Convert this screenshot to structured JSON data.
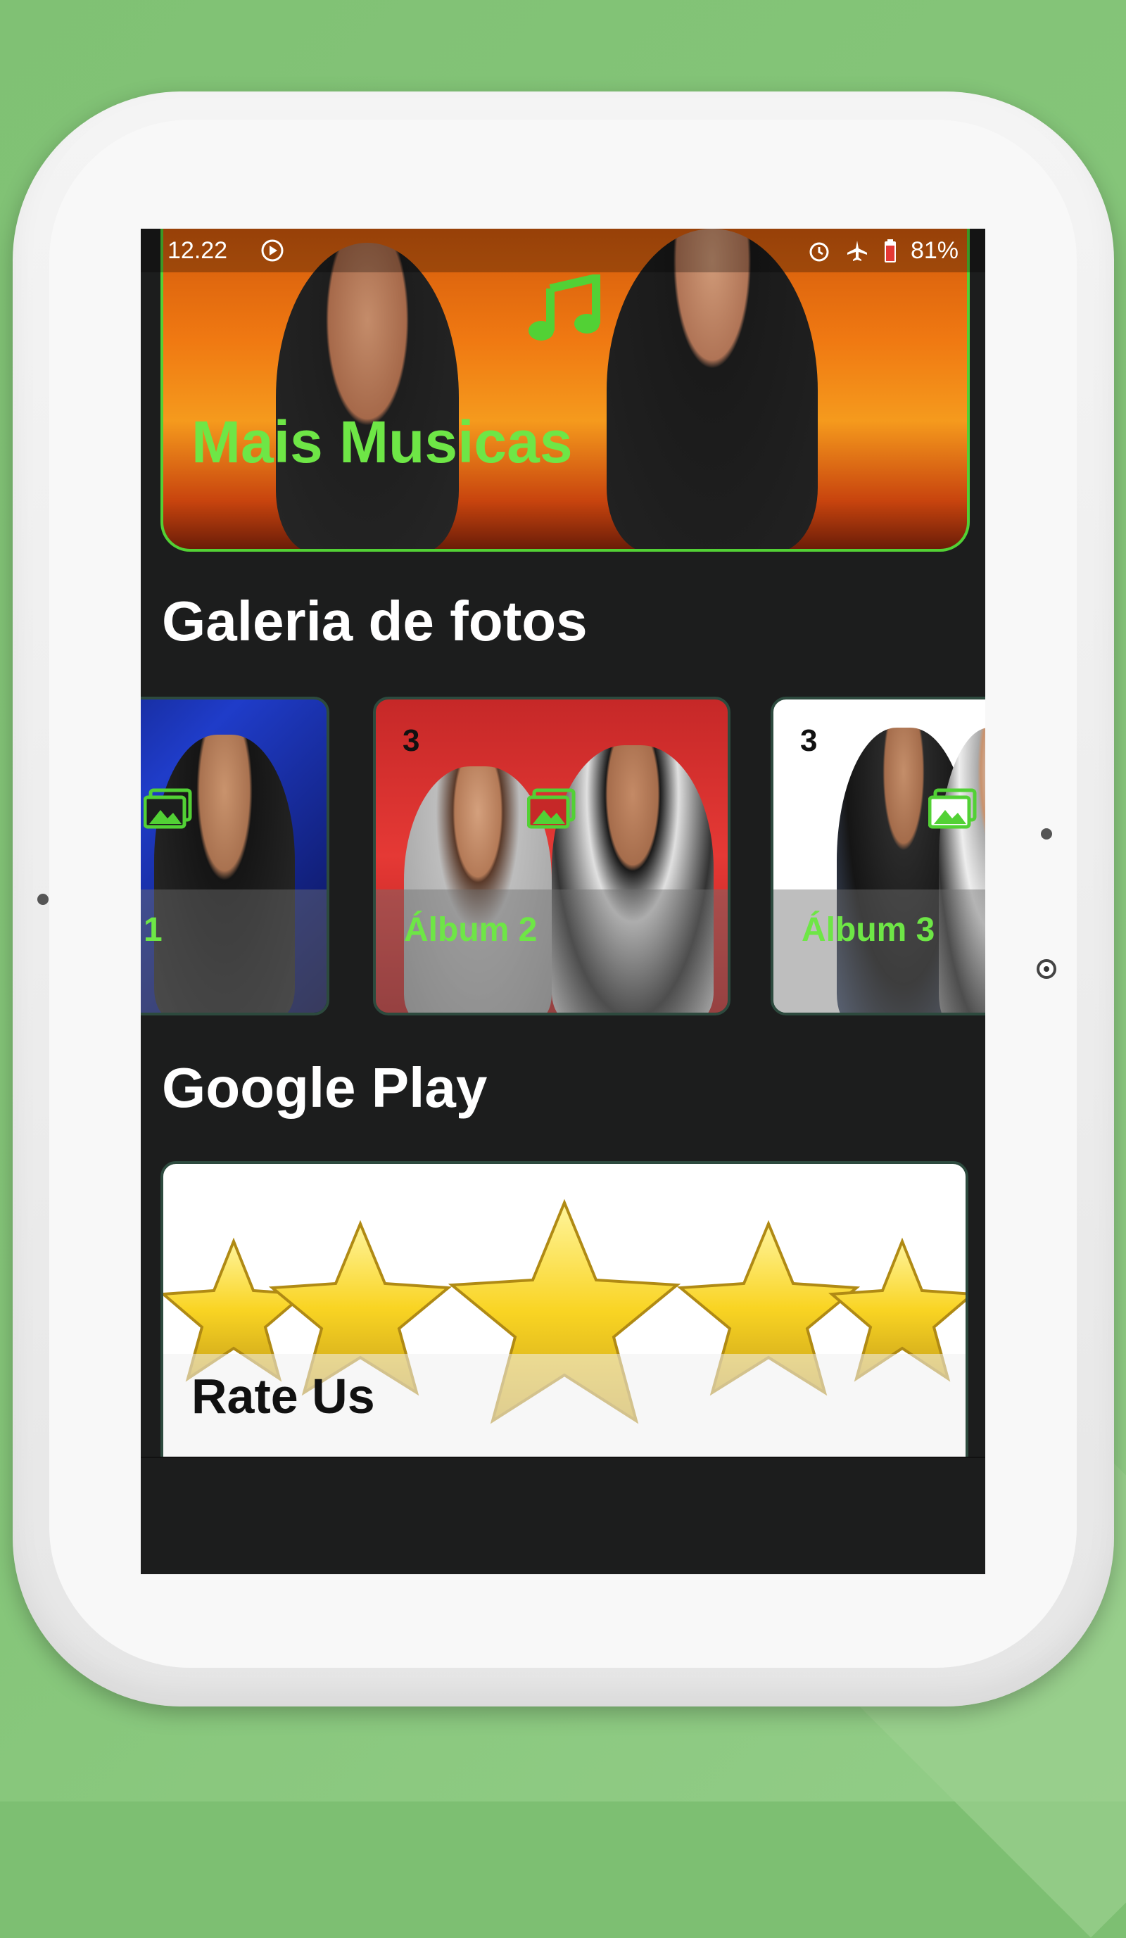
{
  "status_bar": {
    "time": "12.22",
    "battery": "81%"
  },
  "hero": {
    "title": "Mais Musicas",
    "accent_color": "#52d135",
    "icon": "music-note-icon"
  },
  "sections": {
    "gallery_title": "Galeria de fotos",
    "google_play_title": "Google Play"
  },
  "albums": [
    {
      "label": "1",
      "count": ""
    },
    {
      "label": "Álbum 2",
      "count": "3"
    },
    {
      "label": "Álbum 3",
      "count": "3"
    }
  ],
  "rate": {
    "label": "Rate Us"
  }
}
